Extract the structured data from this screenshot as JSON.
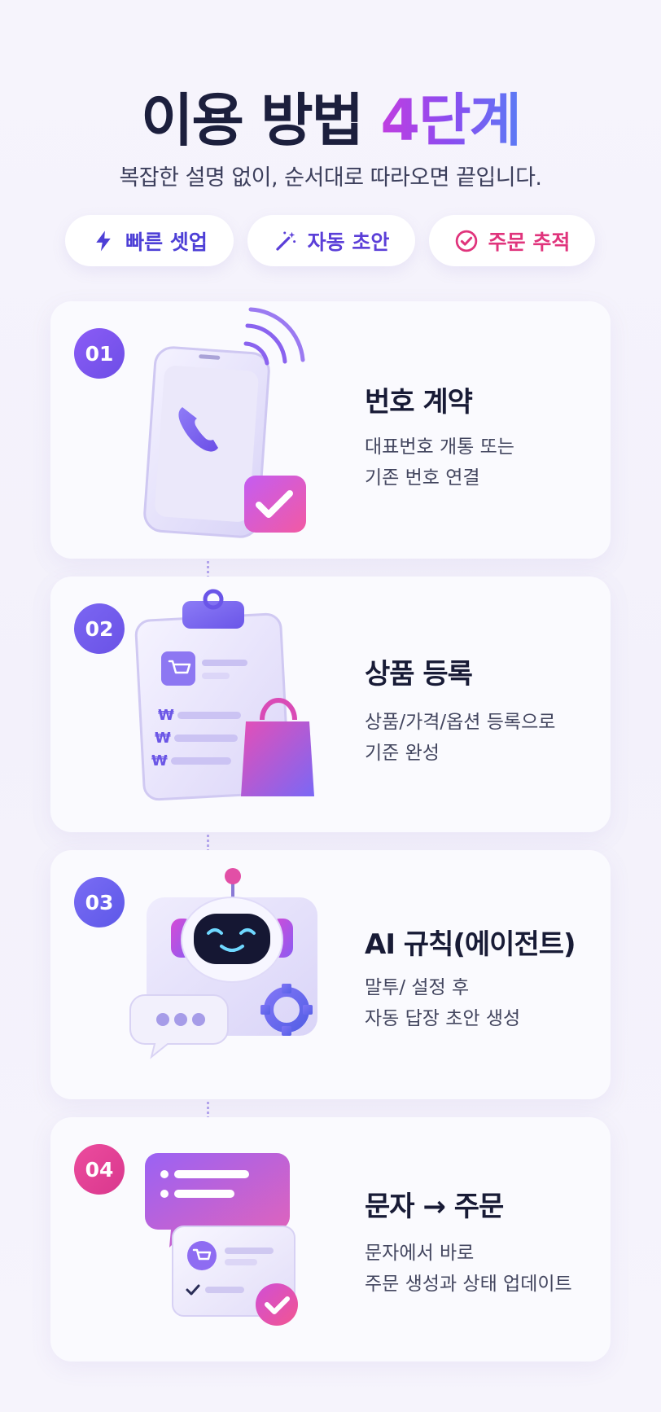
{
  "header": {
    "title_main": "이용 방법",
    "title_accent": "4단계",
    "subtitle": "복잡한 설명 없이, 순서대로 따라오면 끝입니다."
  },
  "chips": [
    {
      "label": "빠른 셋업",
      "icon": "lightning-icon"
    },
    {
      "label": "자동 초안",
      "icon": "magic-wand-icon"
    },
    {
      "label": "주문 추적",
      "icon": "check-circle-icon"
    }
  ],
  "steps": [
    {
      "number": "01",
      "title": "번호 계약",
      "desc_line1": "대표번호 개통 또는",
      "desc_line2": "기존 번호 연결",
      "illustration": "phone-icon"
    },
    {
      "number": "02",
      "title": "상품 등록",
      "desc_line1": "상품/가격/옵션 등록으로",
      "desc_line2": "기준 완성",
      "illustration": "clipboard-icon"
    },
    {
      "number": "03",
      "title": "AI 규칙(에이전트)",
      "desc_line1": "말투/ 설정 후",
      "desc_line2": "자동 답장 초안 생성",
      "illustration": "robot-icon"
    },
    {
      "number": "04",
      "title": "문자 → 주문",
      "desc_line1": "문자에서 바로",
      "desc_line2": "주문 생성과 상태 업데이트",
      "illustration": "message-order-icon"
    }
  ],
  "colors": {
    "accent_purple": "#8b5cf6",
    "accent_pink": "#ec4c9e",
    "text_dark": "#1b1d3a"
  }
}
